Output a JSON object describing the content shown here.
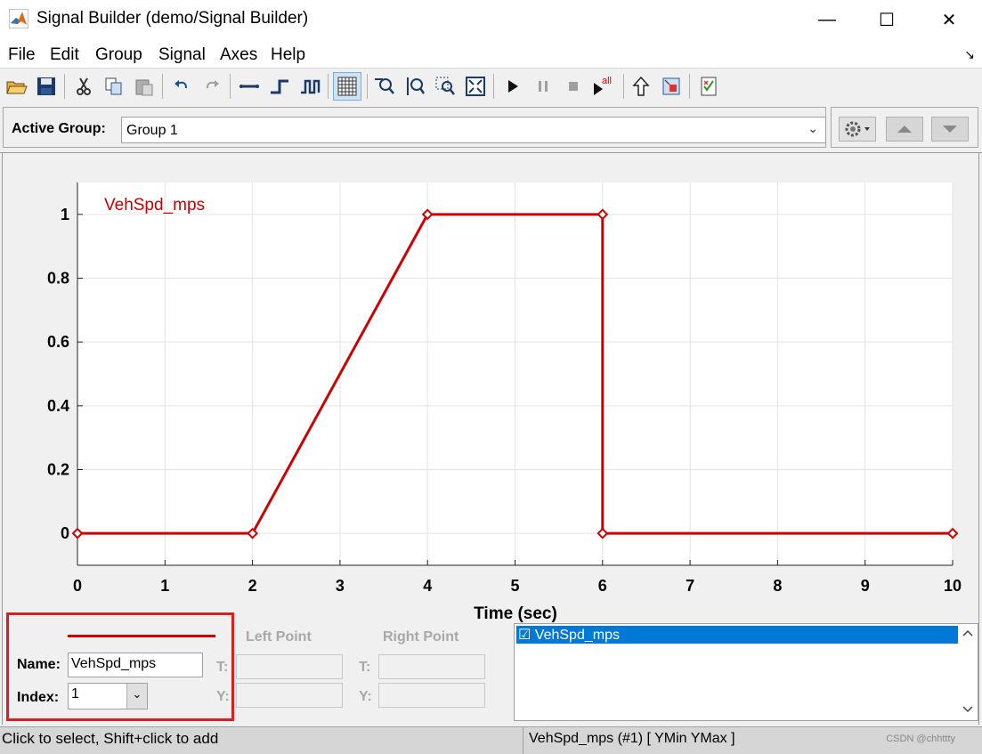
{
  "window": {
    "title": "Signal Builder (demo/Signal Builder)",
    "minimize": "—",
    "maximize": "☐",
    "close": "✕"
  },
  "menu": {
    "items": [
      "File",
      "Edit",
      "Group",
      "Signal",
      "Axes",
      "Help"
    ],
    "overflow_arrow": "↘"
  },
  "toolbar": {
    "icons": [
      "open-icon",
      "save-icon",
      "cut-icon",
      "copy-icon",
      "paste-icon",
      "undo-icon",
      "redo-icon",
      "constant-line-icon",
      "step-up-icon",
      "pulse-icon",
      "grid-icon",
      "zoom-x-icon",
      "zoom-y-icon",
      "zoom-xy-icon",
      "fit-view-icon",
      "run-icon",
      "pause-icon",
      "stop-icon",
      "run-all-icon",
      "up-arrow-icon",
      "show-block-icon",
      "verification-icon"
    ],
    "run_all_label": "all"
  },
  "group_bar": {
    "label": "Active Group:",
    "selected": "Group 1"
  },
  "chart_data": {
    "type": "line",
    "series": [
      {
        "name": "VehSpd_mps",
        "color": "#cc0000",
        "x": [
          0,
          2,
          4,
          6,
          6,
          10
        ],
        "y": [
          0,
          0,
          1,
          1,
          0,
          0
        ]
      }
    ],
    "title": "",
    "legend_label": "VehSpd_mps",
    "xlabel": "Time (sec)",
    "ylabel": "",
    "xlim": [
      0,
      10
    ],
    "ylim": [
      -0.1,
      1.1
    ],
    "xticks": [
      0,
      1,
      2,
      3,
      4,
      5,
      6,
      7,
      8,
      9,
      10
    ],
    "yticks": [
      0,
      0.2,
      0.4,
      0.6,
      0.8,
      1
    ],
    "ytick_labels": [
      "0",
      "0.2",
      "0.4",
      "0.6",
      "0.8",
      "1"
    ],
    "grid": true
  },
  "signal_panel": {
    "name_label": "Name:",
    "name_value": "VehSpd_mps",
    "index_label": "Index:",
    "index_value": "1",
    "line_color": "#cc0000",
    "highlight_color": "#d82020"
  },
  "point_panel": {
    "left_title": "Left Point",
    "right_title": "Right Point",
    "t_label": "T:",
    "y_label": "Y:"
  },
  "signal_list": {
    "items": [
      "☑ VehSpd_mps"
    ]
  },
  "status": {
    "left": "Click to select, Shift+click to add",
    "right": "VehSpd_mps (#1)  [ YMin YMax ]",
    "watermark": "CSDN @chhttty"
  }
}
